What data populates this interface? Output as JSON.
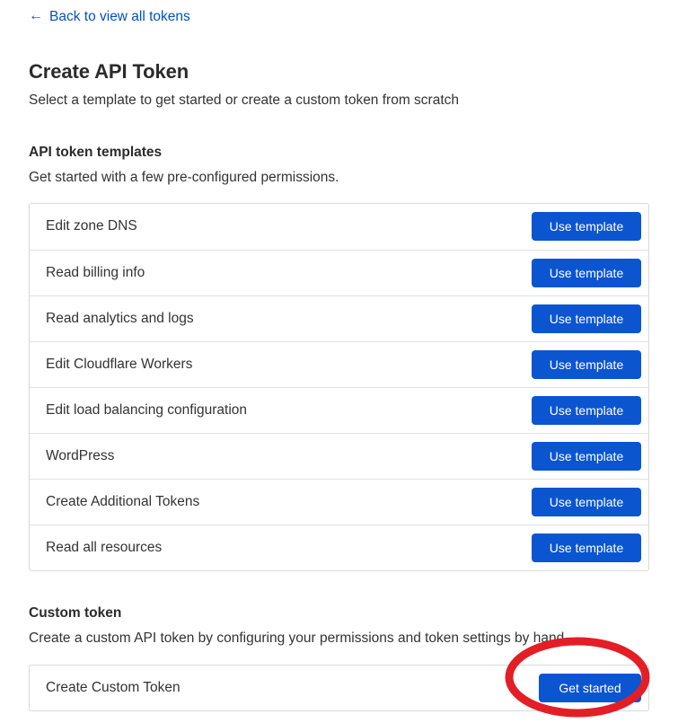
{
  "back_link": {
    "label": "Back to view all tokens",
    "arrow_icon": "arrow-left-icon"
  },
  "header": {
    "title": "Create API Token",
    "subtitle": "Select a template to get started or create a custom token from scratch"
  },
  "templates_section": {
    "title": "API token templates",
    "subtitle": "Get started with a few pre-configured permissions.",
    "button_label": "Use template",
    "items": [
      {
        "label": "Edit zone DNS"
      },
      {
        "label": "Read billing info"
      },
      {
        "label": "Read analytics and logs"
      },
      {
        "label": "Edit Cloudflare Workers"
      },
      {
        "label": "Edit load balancing configuration"
      },
      {
        "label": "WordPress"
      },
      {
        "label": "Create Additional Tokens"
      },
      {
        "label": "Read all resources"
      }
    ]
  },
  "custom_section": {
    "title": "Custom token",
    "subtitle": "Create a custom API token by configuring your permissions and token settings by hand",
    "row_label": "Create Custom Token",
    "button_label": "Get started"
  },
  "colors": {
    "primary_button": "#0b55d1",
    "link": "#0051c3",
    "text": "#333333",
    "heading": "#2b2b2b",
    "border": "#d9d9d9",
    "annotation_red": "#e41e26"
  }
}
